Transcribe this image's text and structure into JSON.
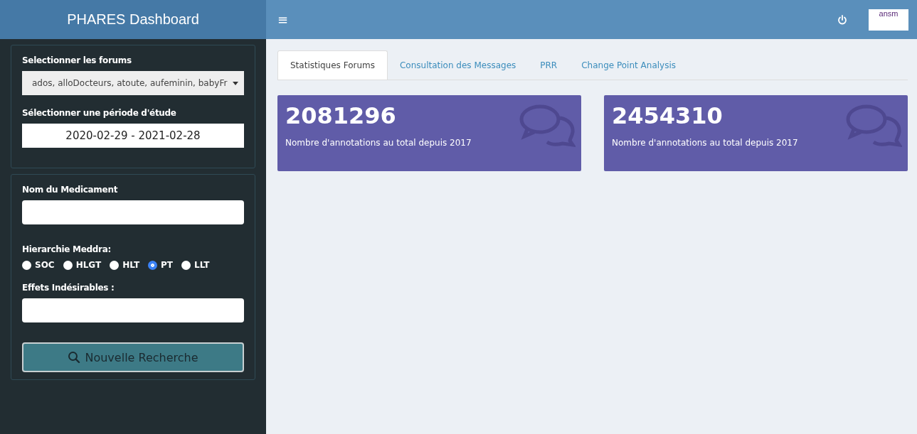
{
  "header": {
    "title": "PHARES Dashboard",
    "menu_icon": "≡",
    "logo_text": "ansm"
  },
  "sidebar": {
    "panels": [
      {
        "fields": [
          {
            "kind": "dropdown",
            "label": "Selectionner les forums",
            "value": "ados, alloDocteurs, atoute, aufeminin, babyFr"
          },
          {
            "kind": "daterange",
            "label": "Sélectionner une période d'étude",
            "value": "2020-02-29 - 2021-02-28"
          }
        ]
      },
      {
        "fields": [
          {
            "kind": "text",
            "label": "Nom du Medicament"
          },
          {
            "kind": "radio",
            "label": "Hierarchie Meddra:",
            "options": [
              {
                "label": "SOC",
                "selected": false
              },
              {
                "label": "HLGT",
                "selected": false
              },
              {
                "label": "HLT",
                "selected": false
              },
              {
                "label": "PT",
                "selected": true
              },
              {
                "label": "LLT",
                "selected": false
              }
            ]
          },
          {
            "kind": "text",
            "label": "Effets Indésirables :"
          },
          {
            "kind": "button",
            "label": "Nouvelle Recherche"
          }
        ]
      }
    ]
  },
  "tabs": [
    {
      "label": "Statistiques Forums",
      "selected": true
    },
    {
      "label": "Consultation des Messages",
      "selected": false
    },
    {
      "label": "PRR",
      "selected": false
    },
    {
      "label": "Change Point Analysis",
      "selected": false
    }
  ],
  "value_boxes": [
    {
      "value": "2081296",
      "caption": "Nombre d'annotations au total depuis 2017"
    },
    {
      "value": "2454310",
      "caption": "Nombre d'annotations au total depuis 2017"
    }
  ]
}
